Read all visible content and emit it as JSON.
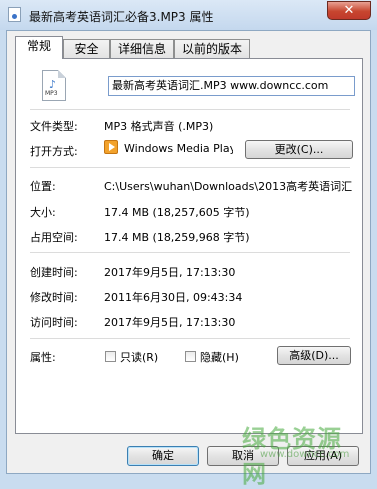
{
  "window": {
    "title": "最新高考英语词汇必备3.MP3 属性",
    "close_glyph": "✕"
  },
  "tabs": [
    {
      "label": "常规",
      "active": true
    },
    {
      "label": "安全",
      "active": false
    },
    {
      "label": "详细信息",
      "active": false
    },
    {
      "label": "以前的版本",
      "active": false
    }
  ],
  "general": {
    "file_icon_text": "MP3",
    "file_name": "最新高考英语词汇.MP3  www.downcc.com",
    "type_label": "文件类型:",
    "type_value": "MP3 格式声音 (.MP3)",
    "open_with_label": "打开方式:",
    "open_with_value": "Windows Media Player",
    "change_button": "更改(C)...",
    "location_label": "位置:",
    "location_value": "C:\\Users\\wuhan\\Downloads\\2013高考英语词汇",
    "size_label": "大小:",
    "size_value": "17.4 MB (18,257,605 字节)",
    "disk_size_label": "占用空间:",
    "disk_size_value": "17.4 MB (18,259,968 字节)",
    "created_label": "创建时间:",
    "created_value": "2017年9月5日, 17:13:30",
    "modified_label": "修改时间:",
    "modified_value": "2011年6月30日, 09:43:34",
    "accessed_label": "访问时间:",
    "accessed_value": "2017年9月5日, 17:13:30",
    "attributes_label": "属性:",
    "readonly_label": "只读(R)",
    "readonly_checked": false,
    "hidden_label": "隐藏(H)",
    "hidden_checked": false,
    "advanced_button": "高级(D)..."
  },
  "footer": {
    "ok_button": "确定",
    "cancel_button": "取消",
    "apply_button": "应用(A)"
  },
  "watermark": {
    "title": "绿色资源网",
    "url": "www.downcc.com"
  },
  "colors": {
    "title_bar": "#c9dcef",
    "close_button": "#c7462f",
    "panel": "#ffffff",
    "dialog": "#f0f0f0"
  }
}
